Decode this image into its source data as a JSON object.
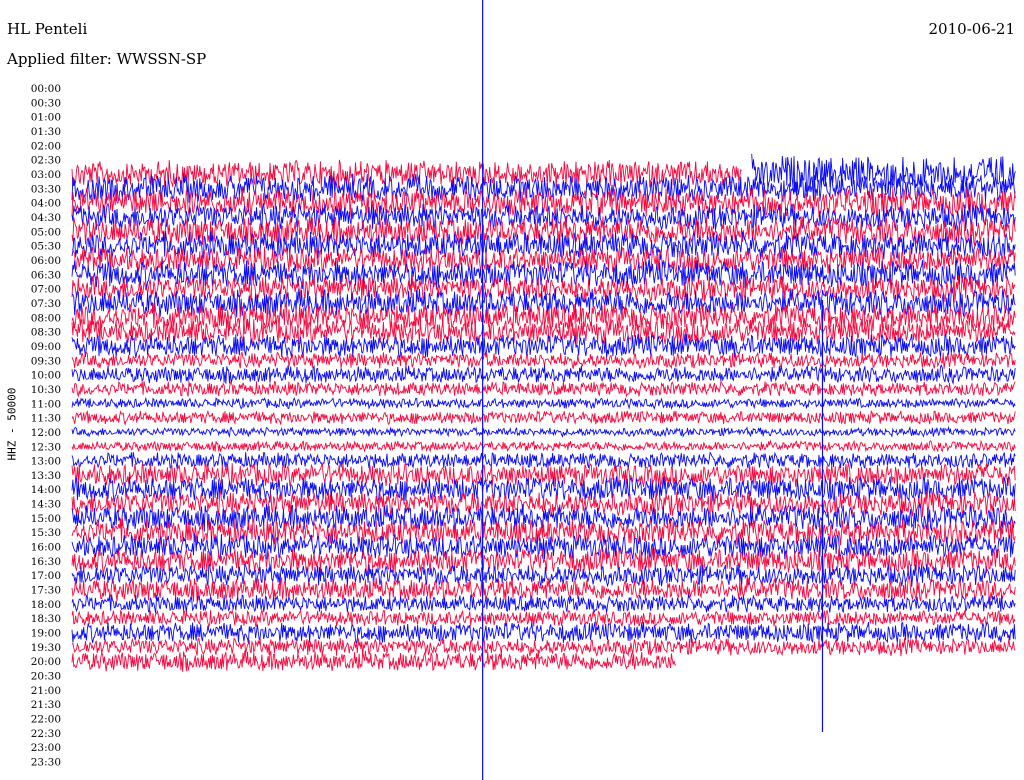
{
  "header": {
    "station": "HL Penteli",
    "filter": "Applied filter: WWSSN-SP",
    "date": "2010-06-21"
  },
  "axis": {
    "channel_label": "HHZ - 50000"
  },
  "colors": {
    "trace_a": "#f5093f",
    "trace_b": "#0b0bf5",
    "background": "#ffffff"
  },
  "chart_data": {
    "type": "line",
    "title": "HL Penteli",
    "subtitle": "Applied filter: WWSSN-SP",
    "ylabel": "HHZ - 50000",
    "y_tick_labels": [
      "00:00",
      "00:30",
      "01:00",
      "01:30",
      "02:00",
      "02:30",
      "03:00",
      "03:30",
      "04:00",
      "04:30",
      "05:00",
      "05:30",
      "06:00",
      "06:30",
      "07:00",
      "07:30",
      "08:00",
      "08:30",
      "09:00",
      "09:30",
      "10:00",
      "10:30",
      "11:00",
      "11:30",
      "12:00",
      "12:30",
      "13:00",
      "13:30",
      "14:00",
      "14:30",
      "15:00",
      "15:30",
      "16:00",
      "16:30",
      "17:00",
      "17:30",
      "18:00",
      "18:30",
      "19:00",
      "19:30",
      "20:00",
      "20:30",
      "21:00",
      "21:30",
      "22:00",
      "22:30",
      "23:00",
      "23:30"
    ],
    "x_range_minutes": [
      0,
      30
    ],
    "traces": [
      {
        "line": "03:00",
        "color": "red",
        "amplitude": 0.95,
        "end_fraction": 0.71
      },
      {
        "line": "03:00",
        "color": "blue",
        "amplitude": 0.0,
        "end_fraction": 1.0,
        "start_fraction": 0.72,
        "note_amplitude": 1.3
      },
      {
        "line": "03:30",
        "color": "blue",
        "amplitude": 0.95
      },
      {
        "line": "04:00",
        "color": "red",
        "amplitude": 1.0
      },
      {
        "line": "04:30",
        "color": "blue",
        "amplitude": 0.9
      },
      {
        "line": "05:00",
        "color": "red",
        "amplitude": 1.0
      },
      {
        "line": "05:30",
        "color": "blue",
        "amplitude": 0.95
      },
      {
        "line": "06:00",
        "color": "red",
        "amplitude": 0.9
      },
      {
        "line": "06:30",
        "color": "blue",
        "amplitude": 0.95
      },
      {
        "line": "07:00",
        "color": "red",
        "amplitude": 0.9
      },
      {
        "line": "07:30",
        "color": "blue",
        "amplitude": 0.95
      },
      {
        "line": "08:00",
        "color": "red",
        "amplitude": 0.95
      },
      {
        "line": "08:30",
        "color": "red",
        "amplitude": 0.85
      },
      {
        "line": "09:00",
        "color": "blue",
        "amplitude": 0.8
      },
      {
        "line": "09:30",
        "color": "red",
        "amplitude": 0.55
      },
      {
        "line": "10:00",
        "color": "blue",
        "amplitude": 0.6
      },
      {
        "line": "10:30",
        "color": "red",
        "amplitude": 0.5
      },
      {
        "line": "11:00",
        "color": "blue",
        "amplitude": 0.35
      },
      {
        "line": "11:30",
        "color": "red",
        "amplitude": 0.45
      },
      {
        "line": "12:00",
        "color": "blue",
        "amplitude": 0.3
      },
      {
        "line": "12:30",
        "color": "red",
        "amplitude": 0.35
      },
      {
        "line": "13:00",
        "color": "blue",
        "amplitude": 0.55
      },
      {
        "line": "13:30",
        "color": "red",
        "amplitude": 0.8
      },
      {
        "line": "14:00",
        "color": "blue",
        "amplitude": 0.85
      },
      {
        "line": "14:30",
        "color": "red",
        "amplitude": 0.85
      },
      {
        "line": "15:00",
        "color": "blue",
        "amplitude": 0.9
      },
      {
        "line": "15:30",
        "color": "red",
        "amplitude": 0.9
      },
      {
        "line": "16:00",
        "color": "blue",
        "amplitude": 0.85
      },
      {
        "line": "16:30",
        "color": "red",
        "amplitude": 0.85
      },
      {
        "line": "17:00",
        "color": "blue",
        "amplitude": 0.75
      },
      {
        "line": "17:30",
        "color": "red",
        "amplitude": 0.8
      },
      {
        "line": "18:00",
        "color": "blue",
        "amplitude": 0.6
      },
      {
        "line": "18:30",
        "color": "red",
        "amplitude": 0.55
      },
      {
        "line": "19:00",
        "color": "blue",
        "amplitude": 0.7
      },
      {
        "line": "19:30",
        "color": "red",
        "amplitude": 0.6
      },
      {
        "line": "20:00",
        "color": "red",
        "amplitude": 0.7,
        "end_fraction": 0.64
      }
    ],
    "grid": false
  }
}
